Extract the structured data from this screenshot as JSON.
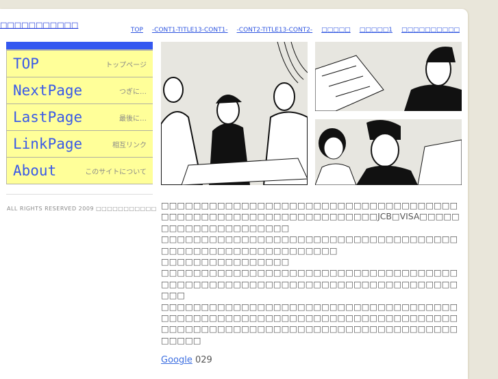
{
  "site_title": "□□□□□□□□□□□",
  "top_nav": [
    "TOP",
    "-CONT1-TITLE13-CONT1-",
    "-CONT2-TITLE13-CONT2-",
    "□□□□□",
    "□□□□□1",
    "□□□□□□□□□□"
  ],
  "sidebar": {
    "items": [
      {
        "label": "TOP",
        "sub": "トップページ"
      },
      {
        "label": "NextPage",
        "sub": "つぎに…"
      },
      {
        "label": "LastPage",
        "sub": "最後に…"
      },
      {
        "label": "LinkPage",
        "sub": "相互リンク"
      },
      {
        "label": "About",
        "sub": "このサイトについて"
      }
    ]
  },
  "footer": "ALL RIGHTS RESERVED 2009 □□□□□□□□□□□",
  "paragraphs": [
    "□□□□□□□□□□□□□□□□□□□□□□□□□□□□□□□□□□□□□□□□□□□□□□□□□□□□□□□□□□□□□□□□JCB□VISA□□□□□□□□□□□□□□□□□□□□□",
    "□□□□□□□□□□□□□□□□□□□□□□□□□□□□□□□□□□□□□□□□□□□□□□□□□□□□□□□□□□□",
    "□□□□□□□□□□□□□□□□",
    "□□□□□□□□□□□□□□□□□□□□□□□□□□□□□□□□□□□□□□□□□□□□□□□□□□□□□□□□□□□□□□□□□□□□□□□□□□□□□",
    "□□□□□□□□□□□□□□□□□□□□□□□□□□□□□□□□□□□□□□□□□□□□□□□□□□□□□□□□□□□□□□□□□□□□□□□□□□□□□□□□□□□□□□□□□□□□□□□□□□□□□□□□□□□□□□□□□□□□"
  ],
  "google_link": "Google",
  "google_suffix": " 029"
}
